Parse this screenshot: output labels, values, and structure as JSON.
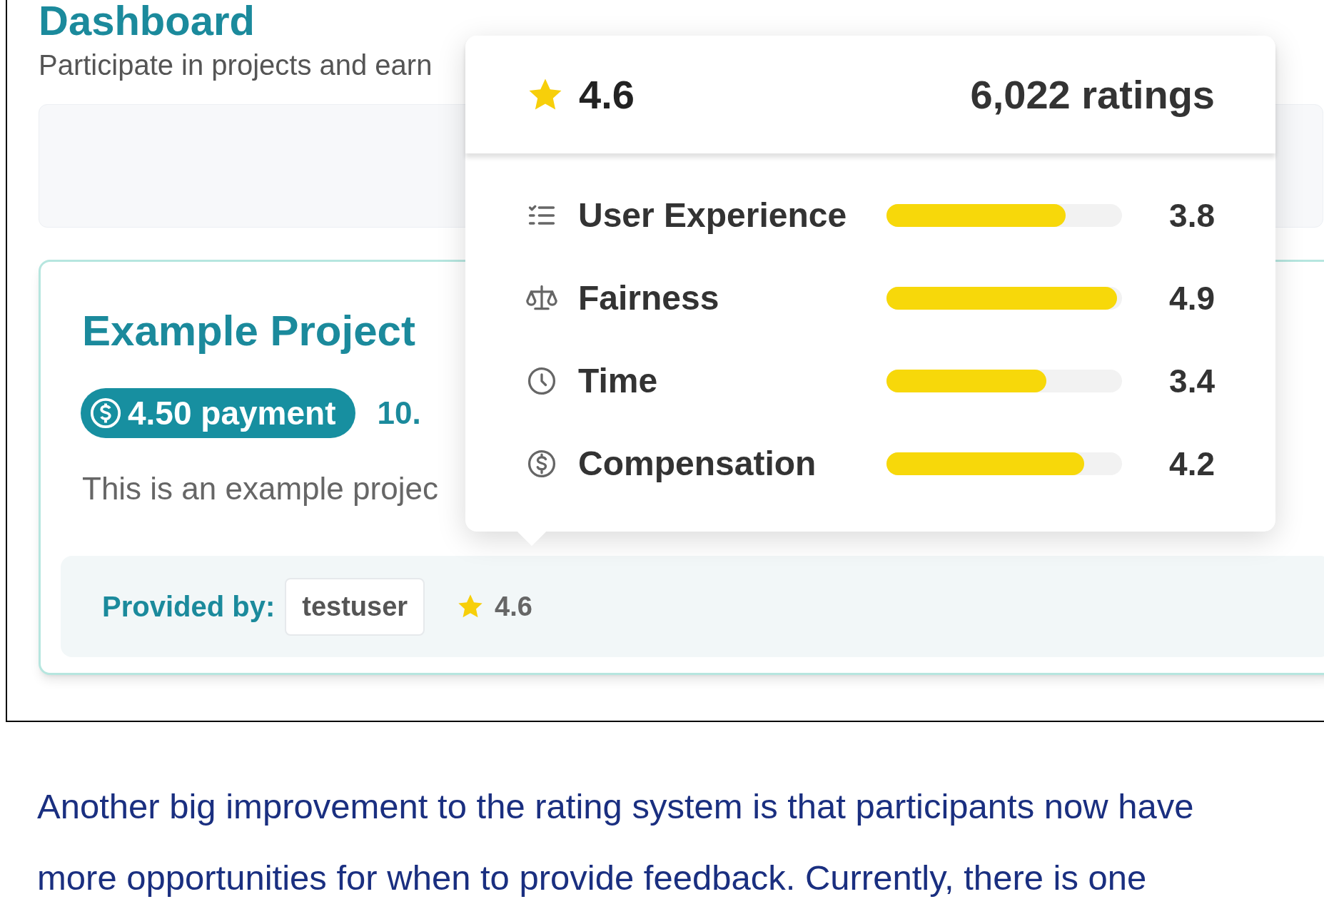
{
  "dashboard": {
    "title": "Dashboard",
    "subtitle": "Participate in projects and earn",
    "project": {
      "title": "Example Project",
      "payment": "4.50 payment",
      "hourly": "10.",
      "description": "This is an example projec",
      "provided_by_label": "Provided by:",
      "provider": "testuser",
      "rating": "4.6"
    }
  },
  "rating_popover": {
    "rating": "4.6",
    "count": "6,022 ratings",
    "categories": [
      {
        "kind": "experience",
        "label": "User Experience",
        "level": 0.76,
        "reading": "3.8"
      },
      {
        "kind": "fairness",
        "label": "Fairness",
        "level": 0.98,
        "reading": "4.9"
      },
      {
        "kind": "time",
        "label": "Time",
        "level": 0.68,
        "reading": "3.4"
      },
      {
        "kind": "compensation",
        "label": "Compensation",
        "level": 0.84,
        "reading": "4.2"
      }
    ]
  },
  "article": {
    "paragraph": "Another big improvement to the rating system is that participants now have more opportunities for when to provide feedback. Currently, there is one"
  }
}
